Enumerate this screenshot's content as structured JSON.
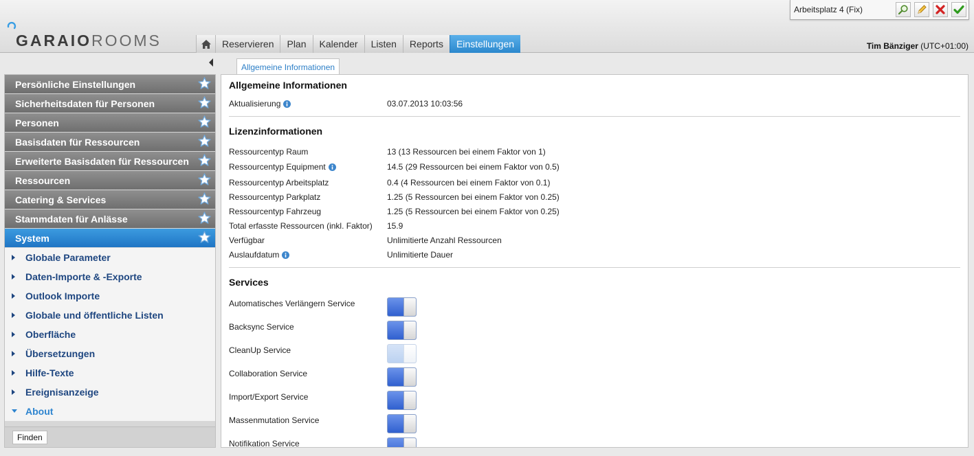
{
  "header": {
    "logo_bold": "GARAIO",
    "logo_light": "ROOMS",
    "workplace": "Arbeitsplatz 4 (Fix)",
    "nav": [
      "Reservieren",
      "Plan",
      "Kalender",
      "Listen",
      "Reports",
      "Einstellungen"
    ],
    "active_nav": "Einstellungen",
    "user_name": "Tim Bänziger",
    "timezone": "(UTC+01:00)"
  },
  "sidebar": {
    "sections": [
      "Persönliche Einstellungen",
      "Sicherheitsdaten für Personen",
      "Personen",
      "Basisdaten für Ressourcen",
      "Erweiterte Basisdaten für Ressourcen",
      "Ressourcen",
      "Catering & Services",
      "Stammdaten für Anlässe",
      "System"
    ],
    "active_section": "System",
    "sub_items": [
      "Globale Parameter",
      "Daten-Importe & -Exporte",
      "Outlook Importe",
      "Globale und öffentliche Listen",
      "Oberfläche",
      "Übersetzungen",
      "Hilfe-Texte",
      "Ereignisanzeige",
      "About"
    ],
    "current_sub": "About",
    "find_button": "Finden"
  },
  "main": {
    "tab": "Allgemeine Informationen",
    "general": {
      "title": "Allgemeine Informationen",
      "update_label": "Aktualisierung",
      "update_value": "03.07.2013 10:03:56"
    },
    "license": {
      "title": "Lizenzinformationen",
      "rows": [
        {
          "label": "Ressourcentyp Raum",
          "value": "13 (13 Ressourcen bei einem Faktor von 1)",
          "info": false
        },
        {
          "label": "Ressourcentyp Equipment",
          "value": "14.5 (29 Ressourcen bei einem Faktor von 0.5)",
          "info": true
        },
        {
          "label": "Ressourcentyp Arbeitsplatz",
          "value": "0.4 (4 Ressourcen bei einem Faktor von 0.1)",
          "info": false
        },
        {
          "label": "Ressourcentyp Parkplatz",
          "value": "1.25 (5 Ressourcen bei einem Faktor von 0.25)",
          "info": false
        },
        {
          "label": "Ressourcentyp Fahrzeug",
          "value": "1.25 (5 Ressourcen bei einem Faktor von 0.25)",
          "info": false
        },
        {
          "label": "Total erfasste Ressourcen (inkl. Faktor)",
          "value": "15.9",
          "info": false
        },
        {
          "label": "Verfügbar",
          "value": "Unlimitierte Anzahl Ressourcen",
          "info": false
        },
        {
          "label": "Auslaufdatum",
          "value": "Unlimitierte Dauer",
          "info": true
        }
      ]
    },
    "services": {
      "title": "Services",
      "items": [
        {
          "label": "Automatisches Verlängern Service",
          "on": true
        },
        {
          "label": "Backsync Service",
          "on": true
        },
        {
          "label": "CleanUp Service",
          "on": false
        },
        {
          "label": "Collaboration Service",
          "on": true
        },
        {
          "label": "Import/Export Service",
          "on": true
        },
        {
          "label": "Massenmutation Service",
          "on": true
        },
        {
          "label": "Notifikation Service",
          "on": true
        }
      ]
    }
  },
  "colors": {
    "accent": "#2b88cd",
    "sidebar_section": "#7d7d7d",
    "sub_item_text": "#1e4680",
    "toggle_on": "#3d6cd6"
  }
}
